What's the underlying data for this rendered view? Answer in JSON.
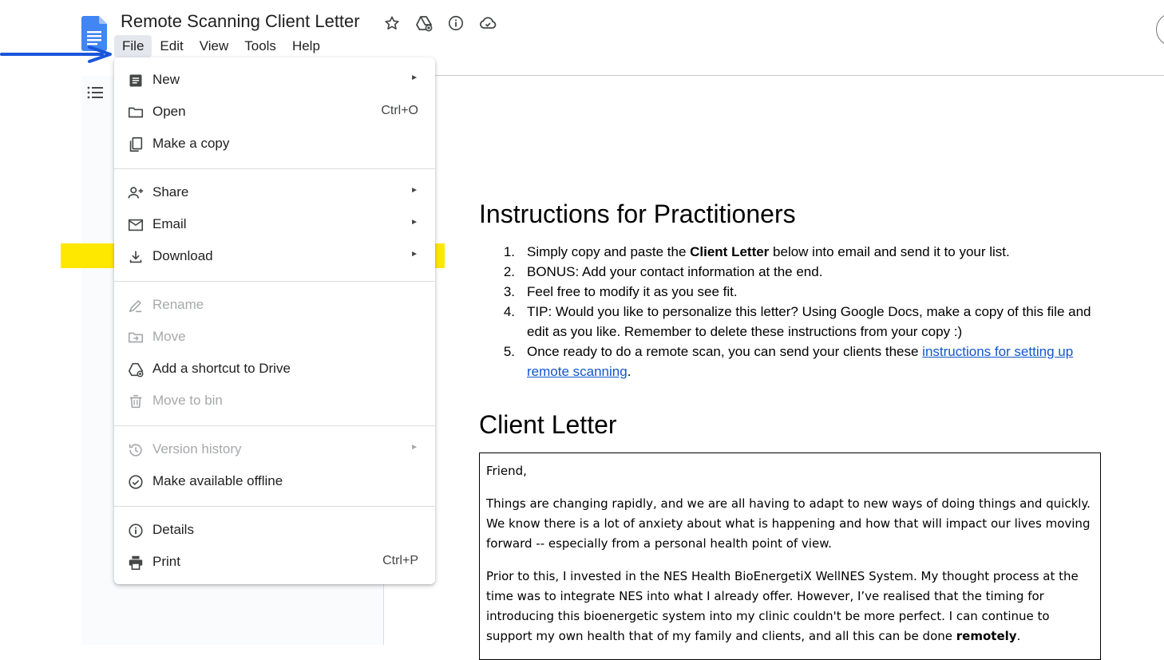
{
  "document": {
    "title": "Remote Scanning Client Letter"
  },
  "menubar": [
    "File",
    "Edit",
    "View",
    "Tools",
    "Help"
  ],
  "file_menu": {
    "new": {
      "label": "New"
    },
    "open": {
      "label": "Open",
      "shortcut": "Ctrl+O"
    },
    "make_copy": {
      "label": "Make a copy"
    },
    "share": {
      "label": "Share"
    },
    "email": {
      "label": "Email"
    },
    "download": {
      "label": "Download"
    },
    "rename": {
      "label": "Rename"
    },
    "move": {
      "label": "Move"
    },
    "add_shortcut": {
      "label": "Add a shortcut to Drive"
    },
    "move_to_bin": {
      "label": "Move to bin"
    },
    "version_history": {
      "label": "Version history"
    },
    "make_offline": {
      "label": "Make available offline"
    },
    "details": {
      "label": "Details"
    },
    "print": {
      "label": "Print",
      "shortcut": "Ctrl+P"
    },
    "submenu_glyph": "►"
  },
  "body": {
    "heading_instructions": "Instructions for Practitioners",
    "instructions": {
      "n1": "1.",
      "i1_a": "Simply copy and paste the ",
      "i1_b": "Client Letter",
      "i1_c": " below into email and send it to your list.",
      "n2": "2.",
      "i2": "BONUS: Add your contact information at the end.",
      "n3": "3.",
      "i3": "Feel free to modify it as you see fit.",
      "n4": "4.",
      "i4": "TIP: Would you like to personalize this letter? Using Google Docs, make a copy of this file and edit as you like. Remember to delete these instructions from your copy :)",
      "n5": "5.",
      "i5_a": "Once ready to do a remote scan, you can send your clients these ",
      "i5_link": "instructions for setting up remote scanning",
      "i5_c": "."
    },
    "heading_letter": "Client Letter",
    "letter": {
      "greeting": "Friend,",
      "p1": "Things are changing rapidly, and we are all having to adapt to new ways of doing things and quickly. We know there is a lot of anxiety about what is happening and how that will impact our lives moving forward -- especially from a personal health point of view.",
      "p2_a": "Prior to this, I invested in the NES Health BioEnergetiX WellNES System. My thought process at the time was to integrate NES into what I already offer. However, I’ve realised that the timing for introducing this bioenergetic system into my clinic couldn't be more perfect. I can continue to support my own health that of my family and clients, and all this can be done ",
      "p2_b": "remotely",
      "p2_c": "."
    }
  },
  "colors": {
    "highlight": "#ffe800",
    "link": "#1155cc",
    "docs_blue": "#4285f4",
    "arrow": "#1a56db"
  }
}
